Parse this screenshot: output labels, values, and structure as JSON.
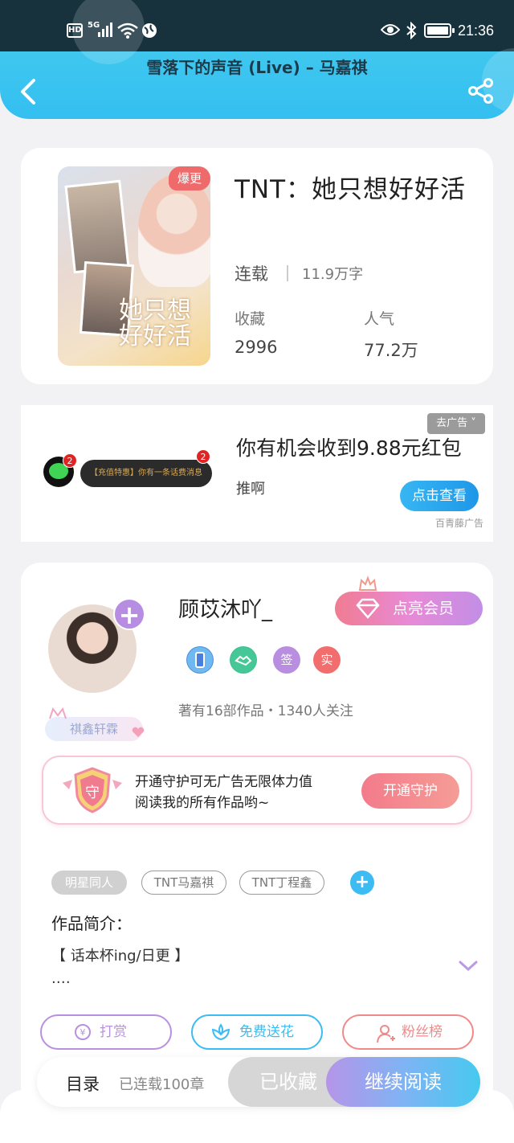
{
  "status_bar": {
    "hd": "HD",
    "network": "5G",
    "time": "21:36"
  },
  "header": {
    "song_title": "雪落下的声音 (Live) – 马嘉祺"
  },
  "book": {
    "cover_tag": "爆更",
    "cover_title": "她只想好好活",
    "title": "TNT：她只想好好活",
    "status": "连载",
    "word_count": "11.9万字",
    "stats": [
      {
        "label": "收藏",
        "value": "2996"
      },
      {
        "label": "人气",
        "value": "77.2万"
      }
    ]
  },
  "ad": {
    "badge_count": "2",
    "pill_text": "【充值特惠】你有一条话费消息",
    "heading": "你有机会收到9.88元红包",
    "brand": "推啊",
    "cta_label": "点击查看",
    "close_label": "去广告 ˅",
    "source": "百青藤广告"
  },
  "author": {
    "name": "顾苡沐吖_",
    "fan_group": "祺鑫轩霖",
    "vip_label": "点亮会员",
    "badges": [
      {
        "icon": "phone-badge-icon",
        "text": "",
        "color": "#4a90e2"
      },
      {
        "icon": "handshake-badge-icon",
        "text": "",
        "color": "#3cc08e"
      },
      {
        "icon": "sign-badge-icon",
        "text": "签",
        "color": "#b98ddf"
      },
      {
        "icon": "verified-badge-icon",
        "text": "实",
        "color": "#f26d6d"
      }
    ],
    "stats_text": "著有16部作品・1340人关注"
  },
  "guard": {
    "icon_char": "守",
    "line1": "开通守护可无广告无限体力值",
    "line2": "阅读我的所有作品哟~",
    "button": "开通守护"
  },
  "tags": [
    "明星同人",
    "TNT马嘉祺",
    "TNT丁程鑫"
  ],
  "intro": {
    "heading": "作品简介：",
    "line1": "【 话本杯ing/日更 】",
    "line2": ".…"
  },
  "actions": [
    {
      "label": "打赏",
      "icon": "coin-icon",
      "color": "#b990df"
    },
    {
      "label": "免费送花",
      "icon": "flower-icon",
      "color": "#3cbcf2"
    },
    {
      "label": "粉丝榜",
      "icon": "fan-rank-icon",
      "color": "#f08a8a"
    }
  ],
  "bottom_bar": {
    "toc_label": "目录",
    "chapters": "已连载100章",
    "saved_label": "已收藏",
    "continue_label": "继续阅读"
  },
  "colors": {
    "header_accent": "#3fc7ef",
    "vip_pink": "#f07c91",
    "continue_purple": "#b695e8"
  }
}
